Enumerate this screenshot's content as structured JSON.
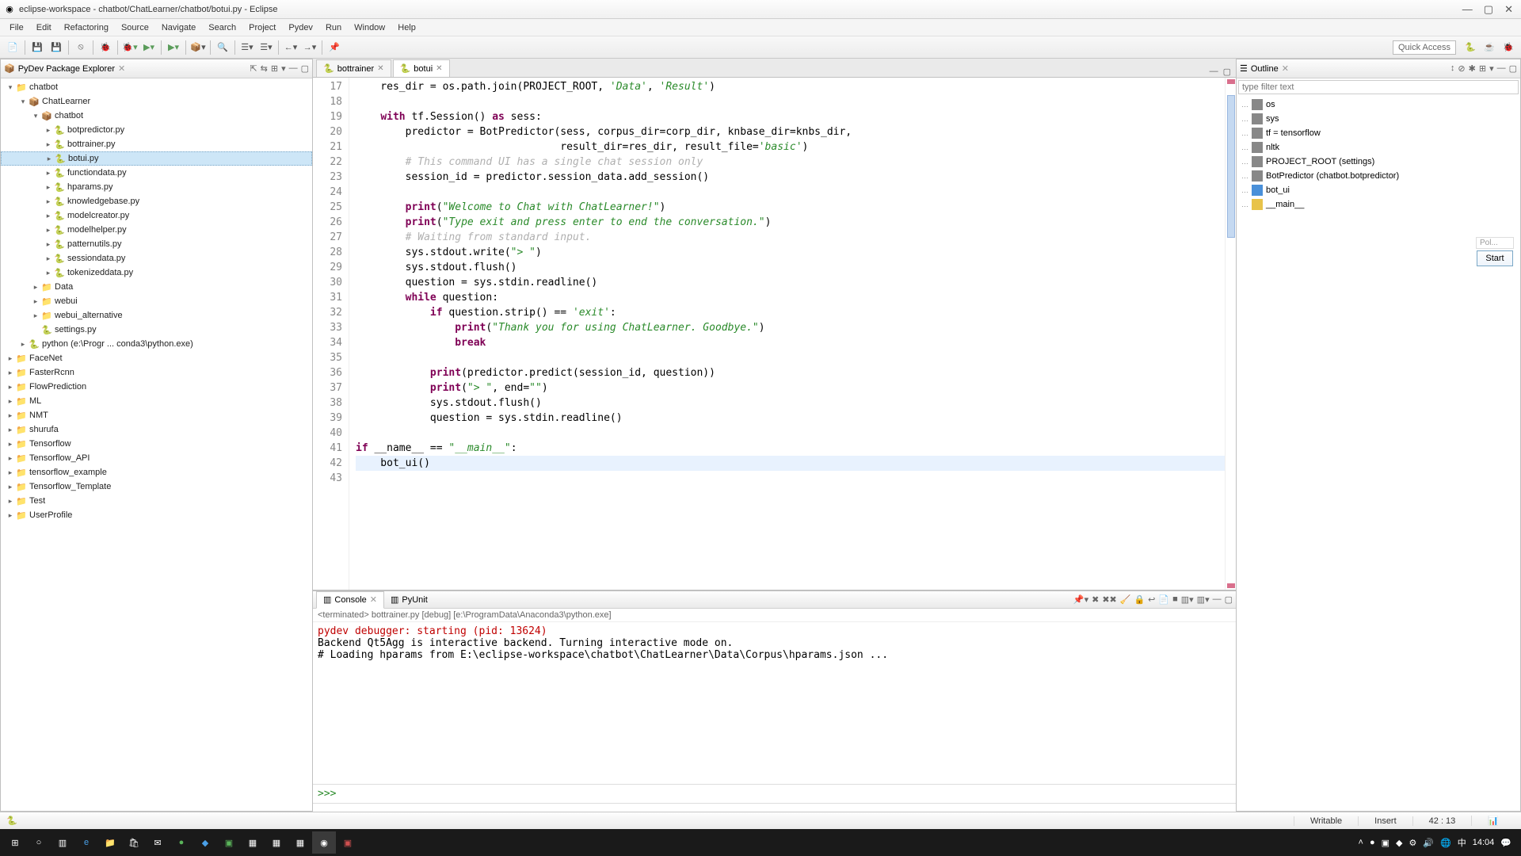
{
  "window": {
    "title": "eclipse-workspace - chatbot/ChatLearner/chatbot/botui.py - Eclipse"
  },
  "menu": [
    "File",
    "Edit",
    "Refactoring",
    "Source",
    "Navigate",
    "Search",
    "Project",
    "Pydev",
    "Run",
    "Window",
    "Help"
  ],
  "quick_access": "Quick Access",
  "left": {
    "title": "PyDev Package Explorer",
    "tree": [
      {
        "label": "chatbot",
        "ind": 0,
        "twist": "▾",
        "icon": "📁"
      },
      {
        "label": "ChatLearner",
        "ind": 1,
        "twist": "▾",
        "icon": "📦"
      },
      {
        "label": "chatbot",
        "ind": 2,
        "twist": "▾",
        "icon": "📦"
      },
      {
        "label": "botpredictor.py",
        "ind": 3,
        "twist": "▸",
        "icon": "🐍"
      },
      {
        "label": "bottrainer.py",
        "ind": 3,
        "twist": "▸",
        "icon": "🐍"
      },
      {
        "label": "botui.py",
        "ind": 3,
        "twist": "▸",
        "icon": "🐍",
        "sel": true
      },
      {
        "label": "functiondata.py",
        "ind": 3,
        "twist": "▸",
        "icon": "🐍"
      },
      {
        "label": "hparams.py",
        "ind": 3,
        "twist": "▸",
        "icon": "🐍"
      },
      {
        "label": "knowledgebase.py",
        "ind": 3,
        "twist": "▸",
        "icon": "🐍"
      },
      {
        "label": "modelcreator.py",
        "ind": 3,
        "twist": "▸",
        "icon": "🐍"
      },
      {
        "label": "modelhelper.py",
        "ind": 3,
        "twist": "▸",
        "icon": "🐍"
      },
      {
        "label": "patternutils.py",
        "ind": 3,
        "twist": "▸",
        "icon": "🐍"
      },
      {
        "label": "sessiondata.py",
        "ind": 3,
        "twist": "▸",
        "icon": "🐍"
      },
      {
        "label": "tokenizeddata.py",
        "ind": 3,
        "twist": "▸",
        "icon": "🐍"
      },
      {
        "label": "Data",
        "ind": 2,
        "twist": "▸",
        "icon": "📁"
      },
      {
        "label": "webui",
        "ind": 2,
        "twist": "▸",
        "icon": "📁"
      },
      {
        "label": "webui_alternative",
        "ind": 2,
        "twist": "▸",
        "icon": "📁"
      },
      {
        "label": "settings.py",
        "ind": 2,
        "twist": "",
        "icon": "🐍"
      },
      {
        "label": "python  (e:\\Progr ... conda3\\python.exe)",
        "ind": 1,
        "twist": "▸",
        "icon": "🐍"
      },
      {
        "label": "FaceNet",
        "ind": 0,
        "twist": "▸",
        "icon": "📁"
      },
      {
        "label": "FasterRcnn",
        "ind": 0,
        "twist": "▸",
        "icon": "📁"
      },
      {
        "label": "FlowPrediction",
        "ind": 0,
        "twist": "▸",
        "icon": "📁"
      },
      {
        "label": "ML",
        "ind": 0,
        "twist": "▸",
        "icon": "📁"
      },
      {
        "label": "NMT",
        "ind": 0,
        "twist": "▸",
        "icon": "📁"
      },
      {
        "label": "shurufa",
        "ind": 0,
        "twist": "▸",
        "icon": "📁"
      },
      {
        "label": "Tensorflow",
        "ind": 0,
        "twist": "▸",
        "icon": "📁"
      },
      {
        "label": "Tensorflow_API",
        "ind": 0,
        "twist": "▸",
        "icon": "📁"
      },
      {
        "label": "tensorflow_example",
        "ind": 0,
        "twist": "▸",
        "icon": "📁"
      },
      {
        "label": "Tensorflow_Template",
        "ind": 0,
        "twist": "▸",
        "icon": "📁"
      },
      {
        "label": "Test",
        "ind": 0,
        "twist": "▸",
        "icon": "📁"
      },
      {
        "label": "UserProfile",
        "ind": 0,
        "twist": "▸",
        "icon": "📁"
      }
    ]
  },
  "editor": {
    "tabs": [
      {
        "label": "bottrainer",
        "active": false
      },
      {
        "label": "botui",
        "active": true
      }
    ],
    "first_line": 17
  },
  "console": {
    "tabs": [
      {
        "label": "Console",
        "active": true
      },
      {
        "label": "PyUnit",
        "active": false
      }
    ],
    "info": "<terminated> bottrainer.py [debug] [e:\\ProgramData\\Anaconda3\\python.exe]",
    "lines": [
      {
        "cls": "red",
        "text": "pydev debugger: starting (pid: 13624)"
      },
      {
        "cls": "blk",
        "text": "Backend Qt5Agg is interactive backend. Turning interactive mode on."
      },
      {
        "cls": "blk",
        "text": "# Loading hparams from E:\\eclipse-workspace\\chatbot\\ChatLearner\\Data\\Corpus\\hparams.json ..."
      }
    ],
    "prompt": ">>> "
  },
  "outline": {
    "title": "Outline",
    "filter_placeholder": "type filter text",
    "items": [
      {
        "label": "os",
        "color": "col-gray"
      },
      {
        "label": "sys",
        "color": "col-gray"
      },
      {
        "label": "tf = tensorflow",
        "color": "col-gray"
      },
      {
        "label": "nltk",
        "color": "col-gray"
      },
      {
        "label": "PROJECT_ROOT (settings)",
        "color": "col-gray"
      },
      {
        "label": "BotPredictor (chatbot.botpredictor)",
        "color": "col-gray"
      },
      {
        "label": "bot_ui",
        "color": "col-blue"
      },
      {
        "label": "__main__",
        "color": "col-yellow"
      }
    ],
    "start_small": "Pol...",
    "start_label": "Start"
  },
  "status": {
    "writable": "Writable",
    "insert": "Insert",
    "pos": "42 : 13"
  },
  "clock": "14:04"
}
